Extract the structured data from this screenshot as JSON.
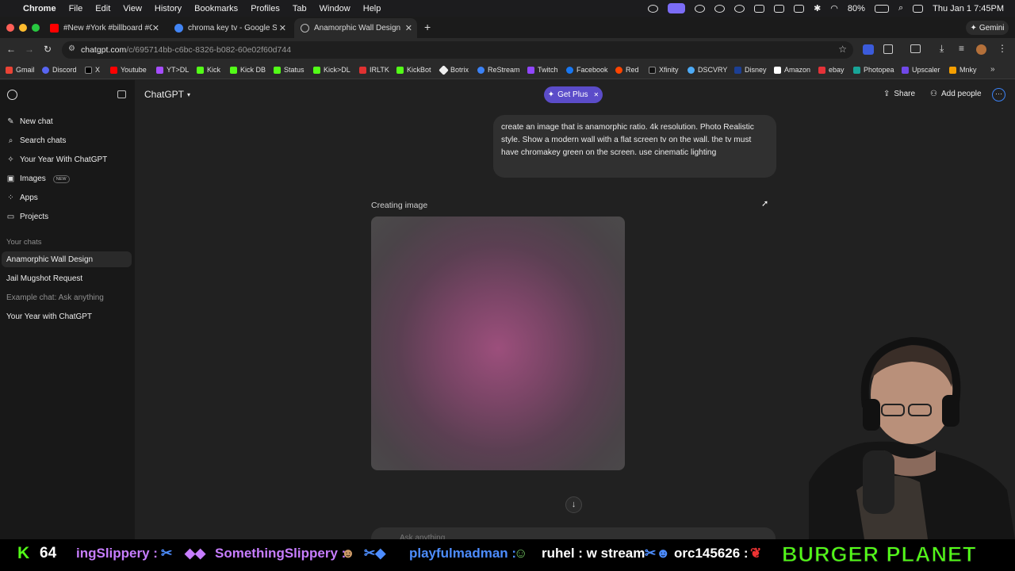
{
  "menubar": {
    "app": "Chrome",
    "items": [
      "File",
      "Edit",
      "View",
      "History",
      "Bookmarks",
      "Profiles",
      "Tab",
      "Window",
      "Help"
    ],
    "battery": "80%",
    "clock": "Thu Jan 1  7:45PM"
  },
  "tabs": [
    {
      "title": "#New #York #billboard #Gree"
    },
    {
      "title": "chroma key tv - Google Searc"
    },
    {
      "title": "Anamorphic Wall Design"
    }
  ],
  "gemini_label": "Gemini",
  "url": {
    "host": "chatgpt.com",
    "path": "/c/695714bb-c6bc-8326-b082-60e02f60d744"
  },
  "bookmarks": [
    "Gmail",
    "Discord",
    "X",
    "Youtube",
    "YT>DL",
    "Kick",
    "Kick DB",
    "Status",
    "Kick>DL",
    "IRLTK",
    "KickBot",
    "Botrix",
    "ReStream",
    "Twitch",
    "Facebook",
    "Red",
    "Xfinity",
    "DSCVRY",
    "Disney",
    "Amazon",
    "ebay",
    "Photopea",
    "Upscaler",
    "Mnky"
  ],
  "sidebar": {
    "items": [
      {
        "label": "New chat",
        "icon": "edit-icon"
      },
      {
        "label": "Search chats",
        "icon": "search-icon"
      },
      {
        "label": "Your Year With ChatGPT",
        "icon": "sparkle-icon"
      },
      {
        "label": "Images",
        "icon": "image-icon",
        "badge": "NEW"
      },
      {
        "label": "Apps",
        "icon": "grid-icon"
      },
      {
        "label": "Projects",
        "icon": "folder-icon"
      }
    ],
    "section_title": "Your chats",
    "chats": [
      "Anamorphic Wall Design",
      "Jail Mugshot Request",
      "Example chat: Ask anything",
      "Your Year with ChatGPT"
    ]
  },
  "header": {
    "model": "ChatGPT",
    "get_plus": "Get Plus",
    "share": "Share",
    "add_people": "Add people"
  },
  "conversation": {
    "user_message": "create an image that is anamorphic ratio. 4k resolution. Photo Realistic style. Show a modern wall with a flat screen tv on the wall. the tv must have chromakey green on the screen. use cinematic lighting",
    "status": "Creating image",
    "composer_placeholder": "Ask anything"
  },
  "stream_overlay": {
    "count_label": "64",
    "ticker": [
      {
        "user": "ingSlippery :",
        "color": "#c77dff"
      },
      {
        "user": "SomethingSlippery :",
        "color": "#c77dff"
      },
      {
        "user": "playfulmadman :",
        "color": "#4d8dff"
      },
      {
        "user": "ruhel : w stream",
        "color": "#ffffff"
      },
      {
        "user": "orc145626 :",
        "color": "#ffffff"
      }
    ],
    "brand": "BURGER PLANET"
  },
  "colors": {
    "accent_plus": "#5b4cc9",
    "kick_green": "#53fc18",
    "sidebar_bg": "#181818",
    "main_bg": "#212121"
  }
}
